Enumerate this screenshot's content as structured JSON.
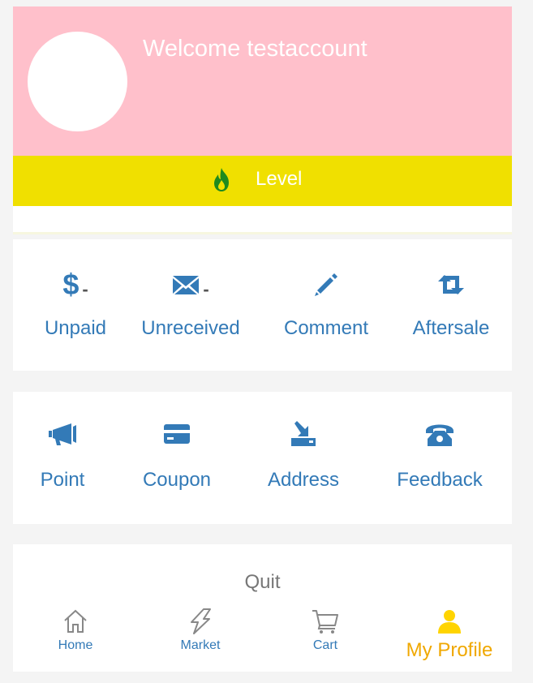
{
  "header": {
    "welcome": "Welcome testaccount"
  },
  "level": {
    "label": "Level",
    "icon": "flame-icon"
  },
  "orders": {
    "items": [
      {
        "label": "Unpaid",
        "icon": "dollar-icon",
        "count": "-"
      },
      {
        "label": "Unreceived",
        "icon": "envelope-icon",
        "count": "-"
      },
      {
        "label": "Comment",
        "icon": "pencil-icon"
      },
      {
        "label": "Aftersale",
        "icon": "retweet-icon"
      }
    ]
  },
  "services": {
    "items": [
      {
        "label": "Point",
        "icon": "bullhorn-icon"
      },
      {
        "label": "Coupon",
        "icon": "credit-card-icon"
      },
      {
        "label": "Address",
        "icon": "download-tray-icon"
      },
      {
        "label": "Feedback",
        "icon": "phone-icon"
      }
    ]
  },
  "quit": {
    "label": "Quit"
  },
  "tabbar": {
    "tabs": [
      {
        "label": "Home",
        "icon": "home-icon"
      },
      {
        "label": "Market",
        "icon": "lightning-icon"
      },
      {
        "label": "Cart",
        "icon": "cart-icon"
      },
      {
        "label": "My Profile",
        "icon": "user-icon",
        "active": true
      }
    ]
  },
  "colors": {
    "header_bg": "#ffc0cb",
    "level_bg": "#f0e000",
    "link_blue": "#337ab7",
    "active_tab": "#f0a800",
    "flame_green": "#1e8a1e"
  }
}
